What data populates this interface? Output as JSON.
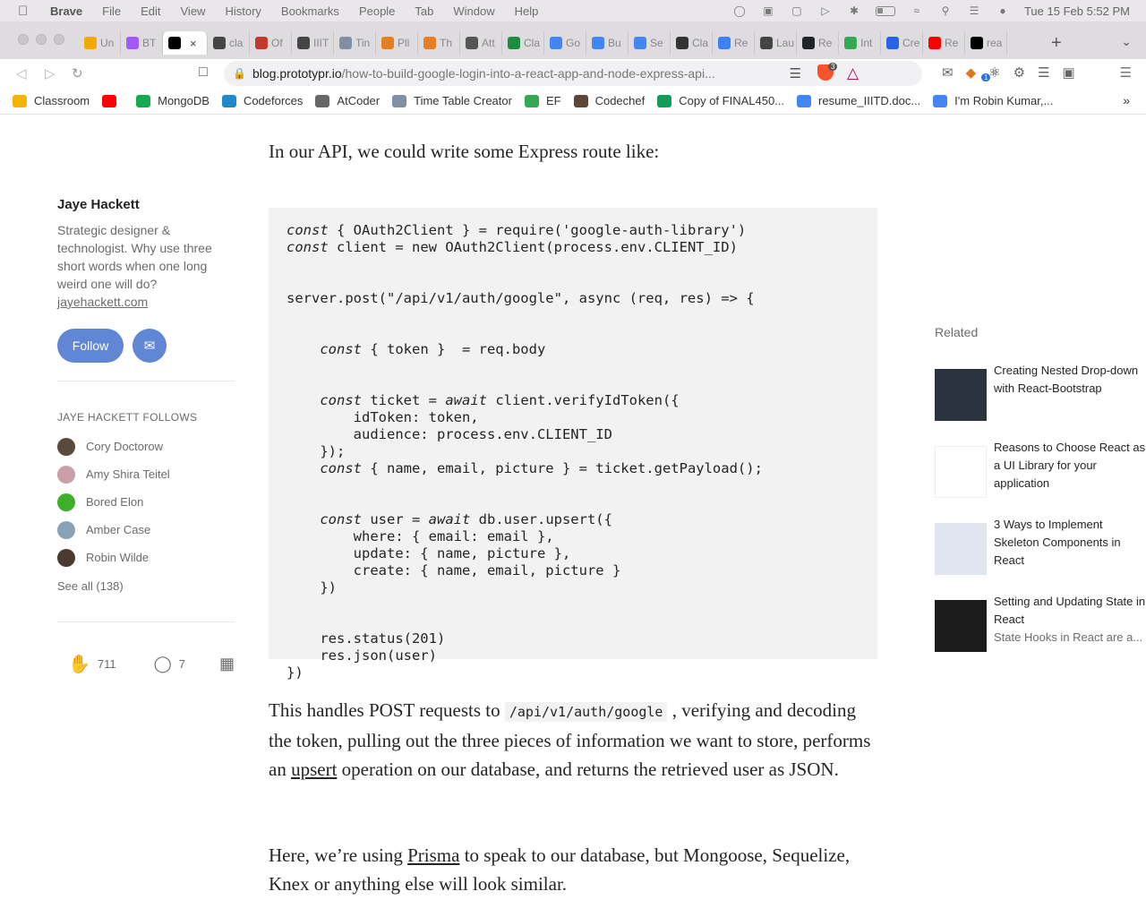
{
  "menubar": {
    "app": "Brave",
    "items": [
      "File",
      "Edit",
      "View",
      "History",
      "Bookmarks",
      "People",
      "Tab",
      "Window",
      "Help"
    ],
    "datetime": "Tue 15 Feb  5:52 PM"
  },
  "tabs": [
    {
      "label": "Un",
      "icon_color": "#f7a800"
    },
    {
      "label": "BT",
      "icon_color": "#a259ff"
    },
    {
      "label": "",
      "icon_color": "#000000",
      "active": true
    },
    {
      "label": "cla",
      "icon_color": "#444444"
    },
    {
      "label": "Of",
      "icon_color": "#c0392b"
    },
    {
      "label": "IIIT",
      "icon_color": "#444444"
    },
    {
      "label": "Tin",
      "icon_color": "#7f8fa6"
    },
    {
      "label": "Pll",
      "icon_color": "#e67e22"
    },
    {
      "label": "Th",
      "icon_color": "#e67e22"
    },
    {
      "label": "Att",
      "icon_color": "#555555"
    },
    {
      "label": "Cla",
      "icon_color": "#1e8e3e"
    },
    {
      "label": "Go",
      "icon_color": "#4285f4"
    },
    {
      "label": "Bu",
      "icon_color": "#4285f4"
    },
    {
      "label": "Se",
      "icon_color": "#4285f4"
    },
    {
      "label": "Cla",
      "icon_color": "#333333"
    },
    {
      "label": "Re",
      "icon_color": "#3b82f6"
    },
    {
      "label": "Lau",
      "icon_color": "#444444"
    },
    {
      "label": "Re",
      "icon_color": "#20232a"
    },
    {
      "label": "Int",
      "icon_color": "#34a853"
    },
    {
      "label": "Cre",
      "icon_color": "#2563eb"
    },
    {
      "label": "Re",
      "icon_color": "#ff0000"
    },
    {
      "label": "rea",
      "icon_color": "#000000"
    }
  ],
  "toolbar": {
    "url_host": "blog.prototypr.io",
    "url_path": "/how-to-build-google-login-into-a-react-app-and-node-express-api...",
    "shield_count": "3",
    "ext_badge": "1"
  },
  "bookmarks": [
    {
      "label": "Classroom",
      "icon_color": "#f5b400"
    },
    {
      "label": "",
      "icon_color": "#ff0000"
    },
    {
      "label": "MongoDB",
      "icon_color": "#13aa52"
    },
    {
      "label": "Codeforces",
      "icon_color": "#1f8acb"
    },
    {
      "label": "AtCoder",
      "icon_color": "#666666"
    },
    {
      "label": "Time Table Creator",
      "icon_color": "#7f8fa6"
    },
    {
      "label": "EF",
      "icon_color": "#34a853"
    },
    {
      "label": "Codechef",
      "icon_color": "#5b4638"
    },
    {
      "label": "Copy of FINAL450...",
      "icon_color": "#0f9d58"
    },
    {
      "label": "resume_IIITD.doc...",
      "icon_color": "#4285f4"
    },
    {
      "label": "I'm Robin Kumar,...",
      "icon_color": "#4285f4"
    }
  ],
  "article": {
    "p1": "In our API, we could write some Express route like:",
    "code": [
      [
        {
          "t": "const",
          "k": true
        },
        {
          "t": " { OAuth2Client } = require('google-auth-library')"
        }
      ],
      [
        {
          "t": "const",
          "k": true
        },
        {
          "t": " client = new OAuth2Client(process.env.CLIENT_ID)"
        }
      ],
      [],
      [],
      [
        {
          "t": "server.post(\"/api/v1/auth/google\", async (req, res) => {"
        }
      ],
      [],
      [],
      [
        {
          "t": "    "
        },
        {
          "t": "const",
          "k": true
        },
        {
          "t": " { token }  = req.body"
        }
      ],
      [],
      [],
      [
        {
          "t": "    "
        },
        {
          "t": "const",
          "k": true
        },
        {
          "t": " ticket = "
        },
        {
          "t": "await",
          "k": true
        },
        {
          "t": " client.verifyIdToken({"
        }
      ],
      [
        {
          "t": "        idToken: token,"
        }
      ],
      [
        {
          "t": "        audience: process.env.CLIENT_ID"
        }
      ],
      [
        {
          "t": "    });"
        }
      ],
      [
        {
          "t": "    "
        },
        {
          "t": "const",
          "k": true
        },
        {
          "t": " { name, email, picture } = ticket.getPayload();"
        }
      ],
      [],
      [],
      [
        {
          "t": "    "
        },
        {
          "t": "const",
          "k": true
        },
        {
          "t": " user = "
        },
        {
          "t": "await",
          "k": true
        },
        {
          "t": " db.user.upsert({"
        }
      ],
      [
        {
          "t": "        where: { email: email },"
        }
      ],
      [
        {
          "t": "        update: { name, picture },"
        }
      ],
      [
        {
          "t": "        create: { name, email, picture }"
        }
      ],
      [
        {
          "t": "    })"
        }
      ],
      [],
      [],
      [
        {
          "t": "    res.status(201)"
        }
      ],
      [
        {
          "t": "    res.json(user)"
        }
      ],
      [
        {
          "t": "})"
        }
      ]
    ],
    "p2_a": "This handles POST requests to ",
    "p2_code": "/api/v1/auth/google",
    "p2_b": " , verifying and decoding the token, pulling out the three pieces of information we want to store, performs an ",
    "p2_link": "upsert",
    "p2_c": " operation on our database, and returns the retrieved user as JSON.",
    "p3_a": "Here, we’re using ",
    "p3_link": "Prisma",
    "p3_b": " to speak to our database, but Mongoose, Sequelize, Knex or anything else will look similar."
  },
  "author": {
    "name": "Jaye Hackett",
    "bio": "Strategic designer & technologist. Why use three short words when one long weird one will do?",
    "site": "jayehackett.com",
    "follow_label": "Follow",
    "follows_title": "JAYE HACKETT FOLLOWS",
    "follows": [
      {
        "name": "Cory Doctorow",
        "color": "#5a4a3a"
      },
      {
        "name": "Amy Shira Teitel",
        "color": "#c9a0a8"
      },
      {
        "name": "Bored Elon",
        "color": "#3fae2a"
      },
      {
        "name": "Amber Case",
        "color": "#8aa2b8"
      },
      {
        "name": "Robin Wilde",
        "color": "#4a3a2f"
      }
    ],
    "see_all": "See all (138)",
    "claps": "711",
    "responses": "7"
  },
  "related": {
    "title": "Related",
    "items": [
      {
        "title": "Creating Nested Drop-down with React-Bootstrap",
        "sub": "",
        "thumb": "#2b3340"
      },
      {
        "title": "Reasons to Choose React as a UI Library for your application",
        "sub": "",
        "thumb": "#ffffff"
      },
      {
        "title": "3 Ways to Implement Skeleton Components in React",
        "sub": "",
        "thumb": "#dfe6f0"
      },
      {
        "title": "Setting and Updating State in React",
        "sub": "State Hooks in React are a...",
        "thumb": "#1b1b1b"
      }
    ]
  }
}
